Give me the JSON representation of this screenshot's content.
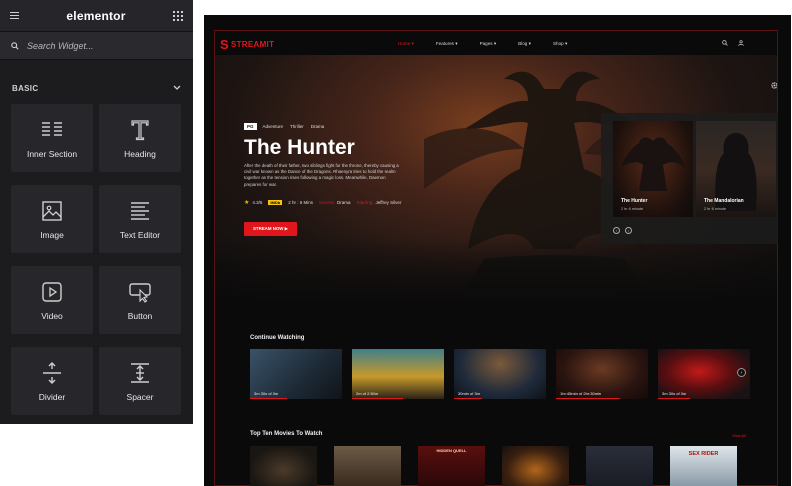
{
  "panel": {
    "brand": "elementor",
    "search_placeholder": "Search Widget...",
    "category": "BASIC",
    "widgets": [
      {
        "label": "Inner Section",
        "icon": "inner-section-icon"
      },
      {
        "label": "Heading",
        "icon": "heading-icon"
      },
      {
        "label": "Image",
        "icon": "image-icon"
      },
      {
        "label": "Text Editor",
        "icon": "text-editor-icon"
      },
      {
        "label": "Video",
        "icon": "video-icon"
      },
      {
        "label": "Button",
        "icon": "button-icon"
      },
      {
        "label": "Divider",
        "icon": "divider-icon"
      },
      {
        "label": "Spacer",
        "icon": "spacer-icon"
      }
    ]
  },
  "site": {
    "logo_letter": "S",
    "logo_text": "STREAMIT",
    "menu": [
      "Home ▾",
      "Features ▾",
      "Pages ▾",
      "Blog ▾",
      "Shop ▾"
    ],
    "hero": {
      "rating_box": "PG",
      "genres": [
        "Adventure",
        "Thriller",
        "Drama"
      ],
      "title": "The Hunter",
      "description": "After the death of their father, two siblings fight for the throne, thereby causing a civil war known as the Dance of the Dragons. Rhaenyra tries to hold the realm together as the tension rises following a magic loss. Meanwhile, Daemon prepares for war.",
      "score": "4.3/5",
      "imdb": "IMDb",
      "duration": "2 hr : 6 Mins",
      "genres_label": "Genres:",
      "genres_value": "Drama",
      "starring_label": "Starring:",
      "starring_value": "Jeffrey Silver",
      "cta": "STREAM NOW ▶"
    },
    "slider": [
      {
        "title": "The Hunter",
        "sub": "2 hr 6 minute"
      },
      {
        "title": "The Mandalorian",
        "sub": "2 hr 6 minute"
      }
    ],
    "continue_title": "Continue Watching",
    "continue": [
      {
        "time": "3m 30s of 3m",
        "progress": 0.4
      },
      {
        "time": "2m of 2:50m",
        "progress": 0.55
      },
      {
        "time": "30min of 3m",
        "progress": 0.3
      },
      {
        "time": "1hr:45min of 2hr:30min",
        "progress": 0.7
      },
      {
        "time": "3m 30s of 3m",
        "progress": 0.35
      }
    ],
    "topten_title": "Top Ten Movies To Watch",
    "view_all": "View All",
    "posters": [
      "",
      "",
      "",
      "",
      "",
      "SEX RIDER"
    ],
    "poster3_label": "HIDDEN QUELL"
  }
}
